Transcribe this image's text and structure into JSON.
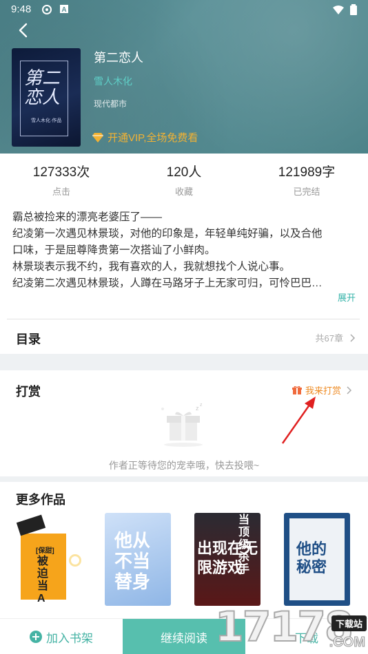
{
  "status_bar": {
    "time": "9:48"
  },
  "book": {
    "title": "第二恋人",
    "author": "雪人木化",
    "genre": "现代都市",
    "vip_text": "开通VIP,全场免费看",
    "cover_title": "第二恋人",
    "cover_sub": "雪人木化·作品"
  },
  "stats": [
    {
      "value": "127333次",
      "label": "点击"
    },
    {
      "value": "120人",
      "label": "收藏"
    },
    {
      "value": "121989字",
      "label": "已完结"
    }
  ],
  "intro": {
    "lines": [
      "霸总被捡来的漂亮老婆压了——",
      "纪凌第一次遇见林景琰，对他的印象是，年轻单纯好骗，以及合他",
      "口味，于是屈尊降贵第一次搭讪了小鲜肉。",
      "林景琰表示我不约，我有喜欢的人，我就想找个人说心事。",
      "纪凌第二次遇见林景琰，人蹲在马路牙子上无家可归，可怜巴巴…"
    ],
    "expand": "展开"
  },
  "catalog": {
    "title": "目录",
    "count": "共67章"
  },
  "reward": {
    "title": "打赏",
    "link": "我来打赏",
    "empty_msg": "作者正等待您的宠幸哦，快去投喂~"
  },
  "more_works": {
    "title": "更多作品",
    "books": [
      {
        "cover_text": "被迫当A",
        "tag": "[保甜]",
        "colors": [
          "#f6a41b",
          "#fbe3a0"
        ]
      },
      {
        "cover_text": "他从不当替身",
        "colors": [
          "#a9c8ef",
          "#6f9fd9"
        ]
      },
      {
        "cover_text": "出现在无限游戏",
        "top": "当顶级杀手",
        "colors": [
          "#3a2a2a",
          "#7a1d1d"
        ]
      },
      {
        "cover_text": "他的秘密",
        "colors": [
          "#1f4f86",
          "#e8edf3"
        ]
      }
    ]
  },
  "bottom_bar": {
    "add_shelf": "加入书架",
    "continue_read": "继续阅读",
    "download": "下载"
  },
  "watermark": {
    "number": "17178",
    "tag": "下载站",
    "domain": ".COM"
  }
}
